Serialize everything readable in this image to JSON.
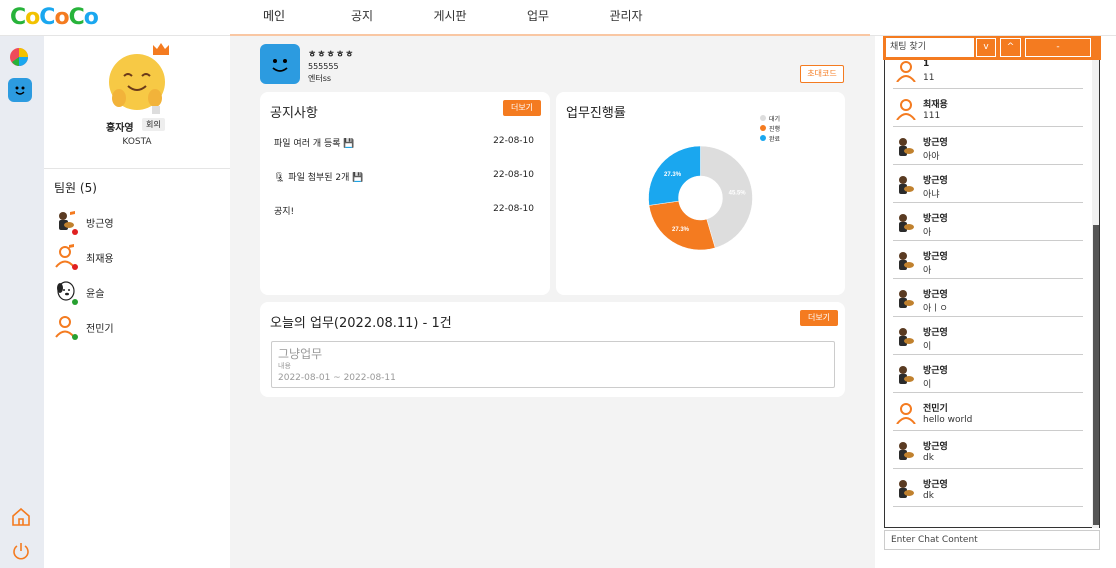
{
  "app": {
    "logo_letters": [
      "C",
      "o",
      "C",
      "o",
      "C",
      "o"
    ]
  },
  "nav": {
    "items": [
      "메인",
      "공지",
      "게시판",
      "업무",
      "관리자"
    ],
    "active": 0
  },
  "profile": {
    "name": "홍자영",
    "role": "회의",
    "org": "KOSTA"
  },
  "team": {
    "title": "팀원 (5)",
    "members": [
      {
        "name": "방근영",
        "status": "offline",
        "leader": true
      },
      {
        "name": "최재용",
        "status": "offline",
        "leader": true
      },
      {
        "name": "윤슬",
        "status": "online",
        "leader": false
      },
      {
        "name": "전민기",
        "status": "online",
        "leader": false
      }
    ]
  },
  "project": {
    "title": "ㅎㅎㅎㅎㅎ",
    "code": "555555",
    "desc": "엔터ss",
    "invite_label": "초대코드"
  },
  "notice": {
    "title": "공지사항",
    "more_label": "더보기",
    "rows": [
      {
        "title": "파일 여러 개 등록 💾",
        "date": "22-08-10"
      },
      {
        "title": "🗜 파일 첨부된 2개 💾",
        "date": "22-08-10"
      },
      {
        "title": "공지!",
        "date": "22-08-10"
      }
    ]
  },
  "progress": {
    "title": "업무진행률",
    "legend": [
      "대기",
      "진행",
      "완료"
    ]
  },
  "chart_data": {
    "type": "pie",
    "title": "업무진행률",
    "categories": [
      "대기",
      "진행",
      "완료"
    ],
    "values": [
      45.5,
      27.3,
      27.3
    ],
    "labels": [
      "45.5%",
      "27.3%",
      "27.3%"
    ],
    "colors": [
      "#dddddd",
      "#f47b20",
      "#1aa7ef"
    ]
  },
  "today": {
    "title": "오늘의 업무(2022.08.11) - 1건",
    "more_label": "더보기",
    "task": {
      "name": "그냥업무",
      "content": "내용",
      "period": "2022-08-01 ~ 2022-08-11"
    }
  },
  "chat": {
    "search_placeholder": "채팅 찾기",
    "btn_down": "v",
    "btn_up": "^",
    "btn_minus": "-",
    "input_placeholder": "Enter Chat Content",
    "messages": [
      {
        "name": "1",
        "text": "11",
        "avatar": "person"
      },
      {
        "name": "최재용",
        "text": "111",
        "avatar": "person"
      },
      {
        "name": "방근영",
        "text": "아아",
        "avatar": "guitar"
      },
      {
        "name": "방근영",
        "text": "아냐",
        "avatar": "guitar"
      },
      {
        "name": "방근영",
        "text": "아",
        "avatar": "guitar"
      },
      {
        "name": "방근영",
        "text": "아",
        "avatar": "guitar"
      },
      {
        "name": "방근영",
        "text": "아ㅣㅇ",
        "avatar": "guitar"
      },
      {
        "name": "방근영",
        "text": "이",
        "avatar": "guitar"
      },
      {
        "name": "방근영",
        "text": "이",
        "avatar": "guitar"
      },
      {
        "name": "전민기",
        "text": "hello world",
        "avatar": "person"
      },
      {
        "name": "방근영",
        "text": "dk",
        "avatar": "guitar"
      },
      {
        "name": "방근영",
        "text": "dk",
        "avatar": "guitar"
      }
    ]
  }
}
